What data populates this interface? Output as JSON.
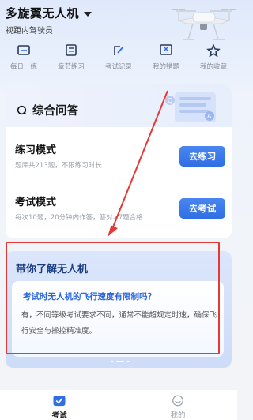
{
  "header": {
    "app_title": "多旋翼无人机",
    "subtitle": "视距内驾驶员"
  },
  "quick_nav": [
    {
      "label": "每日一练",
      "icon": "calendar-icon"
    },
    {
      "label": "章节练习",
      "icon": "list-icon"
    },
    {
      "label": "考试记录",
      "icon": "edit-icon"
    },
    {
      "label": "我的错题",
      "icon": "wrong-icon"
    },
    {
      "label": "我的收藏",
      "icon": "star-icon"
    }
  ],
  "qa_card": {
    "title": "综合问答",
    "practice": {
      "title": "练习模式",
      "desc": "题库共213题，不限练习时长",
      "button": "去练习"
    },
    "exam": {
      "title": "考试模式",
      "desc": "每次10题，20分钟内作答，答对≥7题合格",
      "button": "去考试"
    }
  },
  "intro_card": {
    "title": "带你了解无人机",
    "question": "考试时无人机的飞行速度有限制吗？",
    "answer": "有，不同等级考试要求不同，通常不能超规定时速，确保飞行安全与操控精准度。"
  },
  "tabbar": [
    {
      "label": "考试",
      "icon": "exam-icon",
      "active": true
    },
    {
      "label": "我的",
      "icon": "profile-icon",
      "active": false
    }
  ],
  "colors": {
    "accent": "#2f6ee4",
    "highlight": "#e53935"
  }
}
